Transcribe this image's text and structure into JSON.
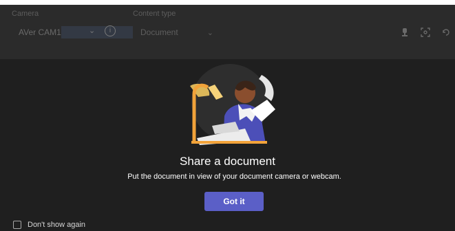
{
  "header": {
    "camera_label": "Camera",
    "camera_value": "AVer CAM1",
    "content_type_label": "Content type",
    "content_type_value": "Document",
    "icons": [
      "camera-settings-icon",
      "focus-frame-icon",
      "rotate-icon"
    ]
  },
  "dialog": {
    "title": "Share a document",
    "description": "Put the document in view of your document camera or webcam.",
    "primary_button": "Got it",
    "checkbox_label": "Don't show again",
    "checkbox_checked": false
  },
  "colors": {
    "background": "#1f1f1f",
    "topbar": "#2b2b2b",
    "accent": "#5b5fc7"
  }
}
